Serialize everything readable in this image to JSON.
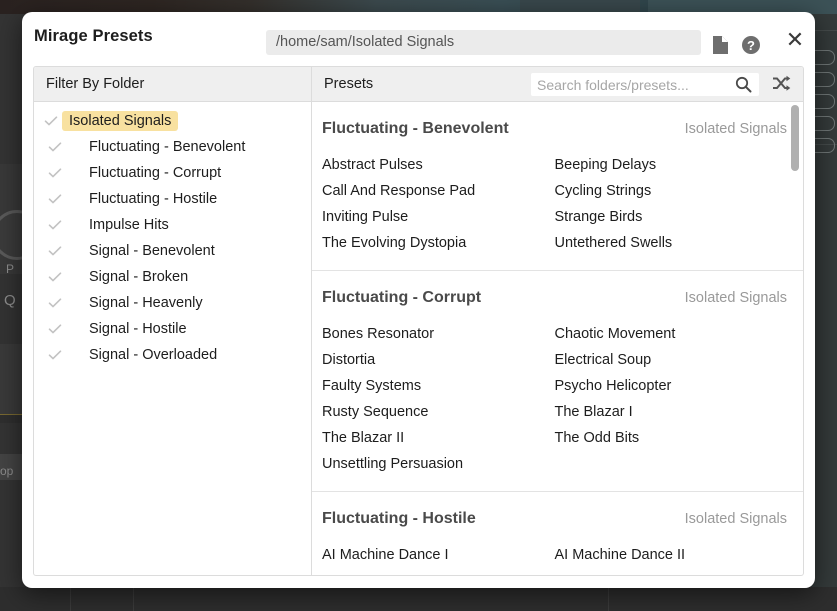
{
  "dialog": {
    "title": "Mirage Presets",
    "path_value": "/home/sam/Isolated Signals",
    "icons": {
      "file": "file-icon",
      "help": "help-icon",
      "close": "✕"
    }
  },
  "filter_panel": {
    "header": "Filter By Folder",
    "items": [
      {
        "label": "Isolated Signals",
        "selected": true,
        "checked": true,
        "root": true
      },
      {
        "label": "Fluctuating - Benevolent",
        "selected": false,
        "checked": true,
        "root": false
      },
      {
        "label": "Fluctuating - Corrupt",
        "selected": false,
        "checked": true,
        "root": false
      },
      {
        "label": "Fluctuating - Hostile",
        "selected": false,
        "checked": true,
        "root": false
      },
      {
        "label": "Impulse Hits",
        "selected": false,
        "checked": true,
        "root": false
      },
      {
        "label": "Signal - Benevolent",
        "selected": false,
        "checked": true,
        "root": false
      },
      {
        "label": "Signal - Broken",
        "selected": false,
        "checked": true,
        "root": false
      },
      {
        "label": "Signal - Heavenly",
        "selected": false,
        "checked": true,
        "root": false
      },
      {
        "label": "Signal - Hostile",
        "selected": false,
        "checked": true,
        "root": false
      },
      {
        "label": "Signal - Overloaded",
        "selected": false,
        "checked": true,
        "root": false
      }
    ]
  },
  "presets_panel": {
    "header": "Presets",
    "search": {
      "placeholder": "Search folders/presets...",
      "value": ""
    },
    "shuffle_icon": "shuffle-icon",
    "search_icon": "search-icon",
    "groups": [
      {
        "title": "Fluctuating - Benevolent",
        "folder": "Isolated Signals",
        "col1": [
          "Abstract Pulses",
          "Call And Response Pad",
          "Inviting Pulse",
          "The Evolving Dystopia"
        ],
        "col2": [
          "Beeping Delays",
          "Cycling Strings",
          "Strange Birds",
          "Untethered Swells"
        ]
      },
      {
        "title": "Fluctuating - Corrupt",
        "folder": "Isolated Signals",
        "col1": [
          "Bones Resonator",
          "Distortia",
          "Faulty Systems",
          "Rusty Sequence",
          "The Blazar II",
          "Unsettling Persuasion"
        ],
        "col2": [
          "Chaotic Movement",
          "Electrical Soup",
          "Psycho Helicopter",
          "The Blazar I",
          "The Odd Bits"
        ]
      },
      {
        "title": "Fluctuating - Hostile",
        "folder": "Isolated Signals",
        "col1": [
          "AI Machine Dance I"
        ],
        "col2": [
          "AI Machine Dance II"
        ]
      }
    ]
  },
  "background": {
    "left_labels": [
      "P",
      "Q",
      "op"
    ]
  },
  "colors": {
    "highlight": "#f8e1a0",
    "dialog_bg": "#ffffff",
    "header_bg": "#efefef",
    "text": "#1d1d1d",
    "muted": "#9a9a9a",
    "scrollbar": "#b0b0b0"
  }
}
